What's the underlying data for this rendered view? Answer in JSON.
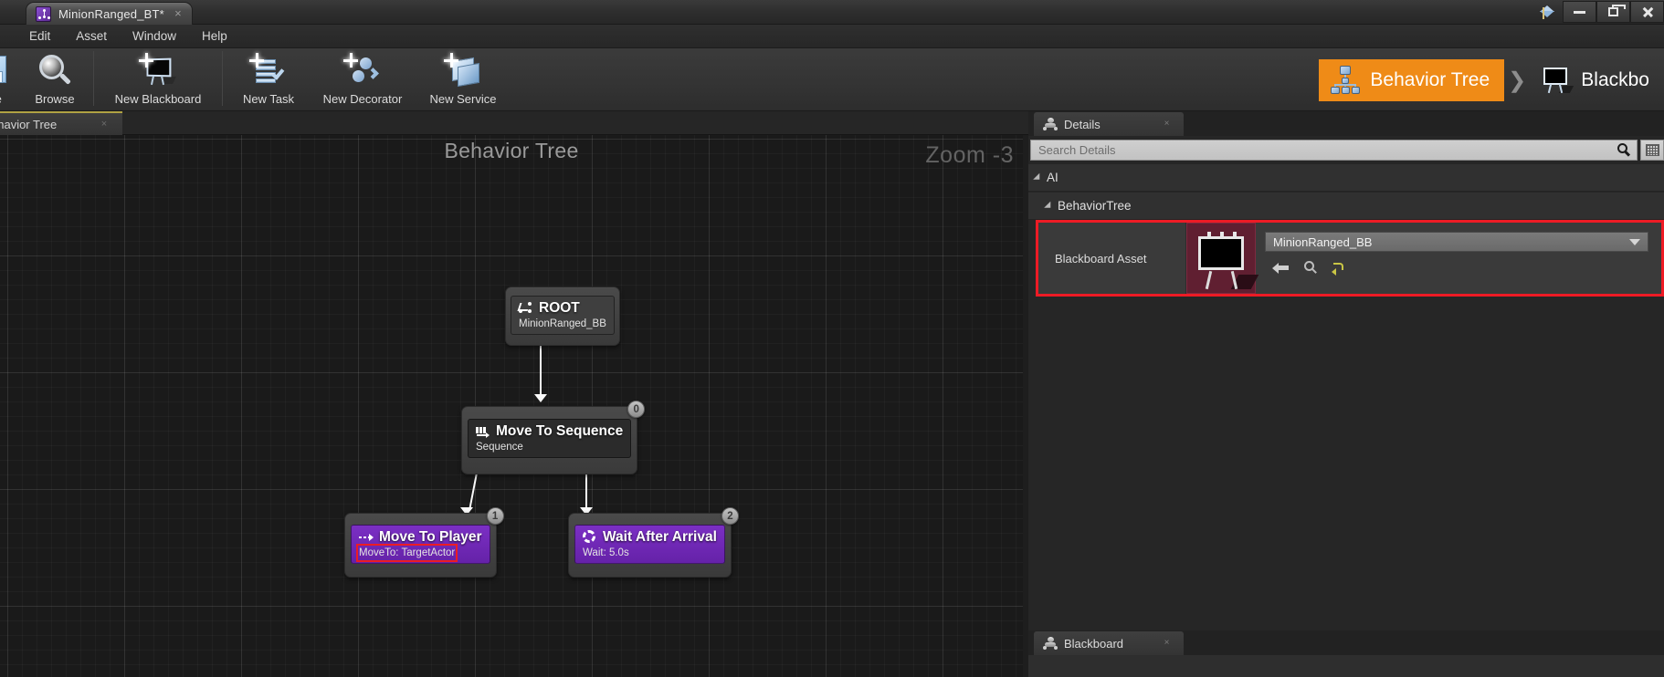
{
  "window": {
    "document_tab": "MinionRanged_BT*",
    "tab_close": "×",
    "minimize": "minimize-icon",
    "restore": "restore-icon",
    "close": "close-icon"
  },
  "menu": {
    "items": [
      "Edit",
      "Asset",
      "Window",
      "Help"
    ]
  },
  "toolbar": {
    "buttons": [
      {
        "label": "ve",
        "icon": "save-icon"
      },
      {
        "label": "Browse",
        "icon": "browse-icon"
      },
      {
        "label": "New Blackboard",
        "icon": "new-blackboard-icon"
      },
      {
        "label": "New Task",
        "icon": "new-task-icon"
      },
      {
        "label": "New Decorator",
        "icon": "new-decorator-icon"
      },
      {
        "label": "New Service",
        "icon": "new-service-icon"
      }
    ],
    "modes": [
      {
        "label": "Behavior Tree",
        "icon": "behavior-tree-icon",
        "active": true
      },
      {
        "label": "Blackbo",
        "icon": "blackboard-icon",
        "active": false
      }
    ],
    "mode_chevron": "❯",
    "accent_color": "#ef8b17"
  },
  "graph": {
    "tab_label": "ehavior Tree",
    "tab_close": "×",
    "title": "Behavior Tree",
    "zoom": "Zoom -3",
    "nodes": [
      {
        "title": "ROOT",
        "subtitle": "MinionRanged_BB",
        "icon": "root-icon",
        "index": "",
        "kind": "root"
      },
      {
        "title": "Move To Sequence",
        "subtitle": "Sequence",
        "icon": "sequence-icon",
        "index": "0",
        "kind": "composite"
      },
      {
        "title": "Move To Player",
        "subtitle": "MoveTo: TargetActor",
        "icon": "move-to-icon",
        "index": "1",
        "kind": "task",
        "subtitle_highlighted": true
      },
      {
        "title": "Wait After Arrival",
        "subtitle": "Wait: 5.0s",
        "icon": "wait-icon",
        "index": "2",
        "kind": "task"
      }
    ],
    "highlight_color": "#ec1c24"
  },
  "details": {
    "tab_label": "Details",
    "tab_icon": "details-icon",
    "tab_close": "×",
    "search": {
      "placeholder": "Search Details",
      "value": "",
      "icon": "search-icon"
    },
    "view_options_icon": "grid-icon",
    "categories": [
      {
        "label": "AI",
        "expanded": true
      },
      {
        "label": "BehaviorTree",
        "expanded": true
      }
    ],
    "property": {
      "name": "Blackboard Asset",
      "value": "MinionRanged_BB",
      "thumbnail": "blackboard-thumbnail",
      "dropdown_icon": "chevron-down-icon",
      "buttons": [
        {
          "icon": "use-selected-asset-icon"
        },
        {
          "icon": "browse-asset-icon"
        },
        {
          "icon": "reset-to-default-icon"
        }
      ],
      "highlighted": true,
      "highlight_color": "#ee1b25"
    }
  },
  "blackboard_panel": {
    "tab_label": "Blackboard",
    "tab_icon": "blackboard-panel-icon",
    "tab_close": "×"
  }
}
